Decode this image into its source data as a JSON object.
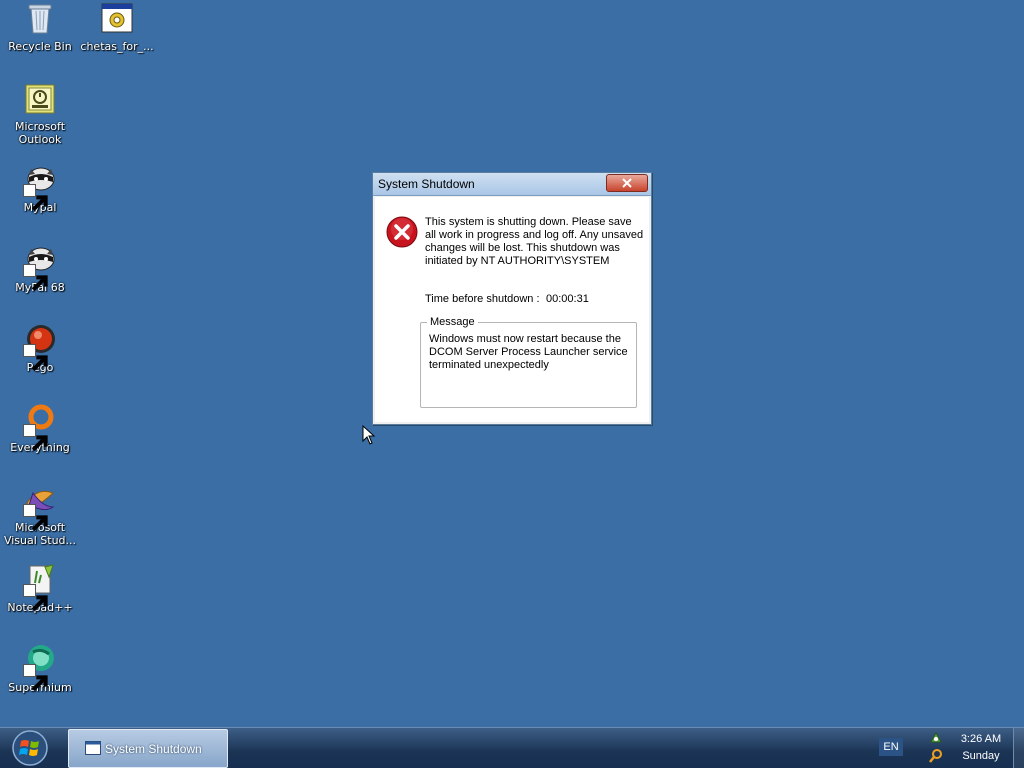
{
  "desktop": {
    "icons": [
      {
        "label": "Recycle Bin",
        "icon": "recycle-bin-icon"
      },
      {
        "label": "chetas_for_...",
        "icon": "application-icon"
      },
      {
        "label": "Microsoft Outlook",
        "icon": "outlook-icon"
      },
      {
        "label": "Mypal",
        "icon": "mypal-icon"
      },
      {
        "label": "MyPal 68",
        "icon": "mypal-icon"
      },
      {
        "label": "Pego",
        "icon": "pego-icon"
      },
      {
        "label": "Everything",
        "icon": "everything-icon"
      },
      {
        "label": "Microsoft Visual Stud...",
        "icon": "visual-studio-icon"
      },
      {
        "label": "Notepad++",
        "icon": "notepad-plus-plus-icon"
      },
      {
        "label": "Supermium",
        "icon": "supermium-icon"
      }
    ]
  },
  "dialog": {
    "title": "System Shutdown",
    "message": "This system is shutting down. Please save all work in progress and log off. Any unsaved changes will be lost. This shutdown was initiated by NT AUTHORITY\\SYSTEM",
    "time_label": "Time before shutdown :",
    "time_value": "00:00:31",
    "group_label": "Message",
    "group_text": "Windows must now restart because the DCOM Server Process Launcher service terminated unexpectedly"
  },
  "taskbar": {
    "start_icon": "windows-logo-icon",
    "task_button_label": "System Shutdown",
    "language": "EN",
    "time": "3:26 AM",
    "day": "Sunday"
  },
  "colors": {
    "desktop": "#3a6ea5",
    "taskbar": "#1b3454",
    "error": "#c8141e"
  }
}
